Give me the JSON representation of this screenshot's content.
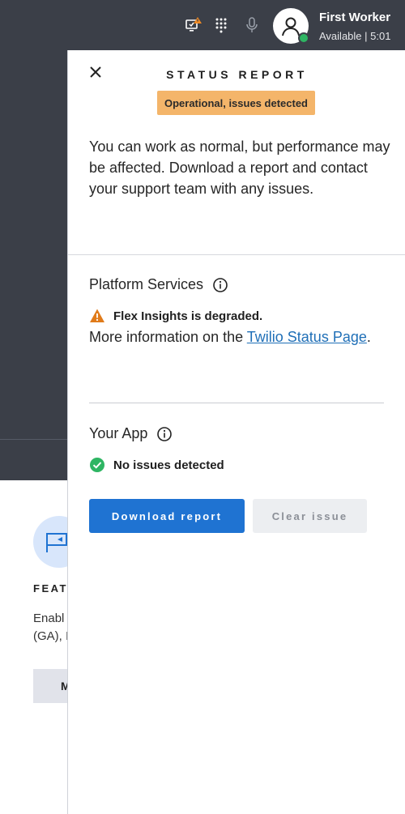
{
  "topbar": {
    "icons": [
      "monitor-alert-icon",
      "dialpad-icon",
      "microphone-icon"
    ],
    "user": {
      "name": "First Worker",
      "status": "Available | 5:01",
      "presence_color": "#2eb563"
    }
  },
  "background_app": {
    "feature_title": "FEAT",
    "feature_desc_line1": "Enabl",
    "feature_desc_line2": "(GA), I",
    "feature_button": "M"
  },
  "status_panel": {
    "title": "STATUS REPORT",
    "badge": "Operational, issues detected",
    "badge_color": "#f4b56a",
    "description": "You can work as normal, but performance may be affected. Download a report and contact your support team with any issues.",
    "platform_services": {
      "title": "Platform Services",
      "alert": "Flex Insights is degraded.",
      "more_info_prefix": "More information on the ",
      "link_text": "Twilio Status Page",
      "more_info_suffix": "."
    },
    "your_app": {
      "title": "Your App",
      "status": "No issues detected"
    },
    "buttons": {
      "download": "Download report",
      "clear": "Clear issue"
    },
    "colors": {
      "primary": "#1f73d2",
      "warning": "#e07b1a",
      "success": "#2eb563"
    }
  }
}
